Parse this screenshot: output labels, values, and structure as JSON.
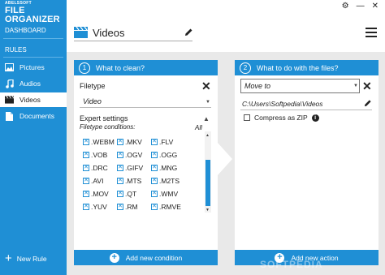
{
  "app": {
    "logo_small": "ABELSSOFT",
    "logo_big": "FILE ORGANIZER"
  },
  "sidebar": {
    "dashboard": "DASHBOARD",
    "rules": "RULES",
    "items": [
      {
        "label": "Pictures",
        "icon": "image-icon"
      },
      {
        "label": "Audios",
        "icon": "music-note-icon"
      },
      {
        "label": "Videos",
        "icon": "clapperboard-icon"
      },
      {
        "label": "Documents",
        "icon": "document-icon"
      }
    ],
    "new_rule": "New Rule"
  },
  "header": {
    "title": "Videos"
  },
  "panel1": {
    "number": "1",
    "title": "What to clean?",
    "filetype_label": "Filetype",
    "filetype_value": "Video",
    "expert_label": "Expert settings",
    "conditions_label": "Filetype conditions:",
    "all_label": "All",
    "extensions": [
      [
        ".WEBM",
        ".MKV",
        ".FLV"
      ],
      [
        ".VOB",
        ".OGV",
        ".OGG"
      ],
      [
        ".DRC",
        ".GIFV",
        ".MNG"
      ],
      [
        ".AVI",
        ".MTS",
        ".M2TS"
      ],
      [
        ".MOV",
        ".QT",
        ".WMV"
      ],
      [
        ".YUV",
        ".RM",
        ".RMVE"
      ]
    ],
    "footer": "Add new condition"
  },
  "panel2": {
    "number": "2",
    "title": "What to do with the files?",
    "action_value": "Move to",
    "path": "C:\\Users\\Softpedia\\Videos",
    "zip_label": "Compress as ZIP",
    "footer": "Add new action"
  },
  "watermark": "SOFTPEDIA",
  "colors": {
    "accent": "#1f8fd5",
    "background": "#e9e9e9"
  }
}
